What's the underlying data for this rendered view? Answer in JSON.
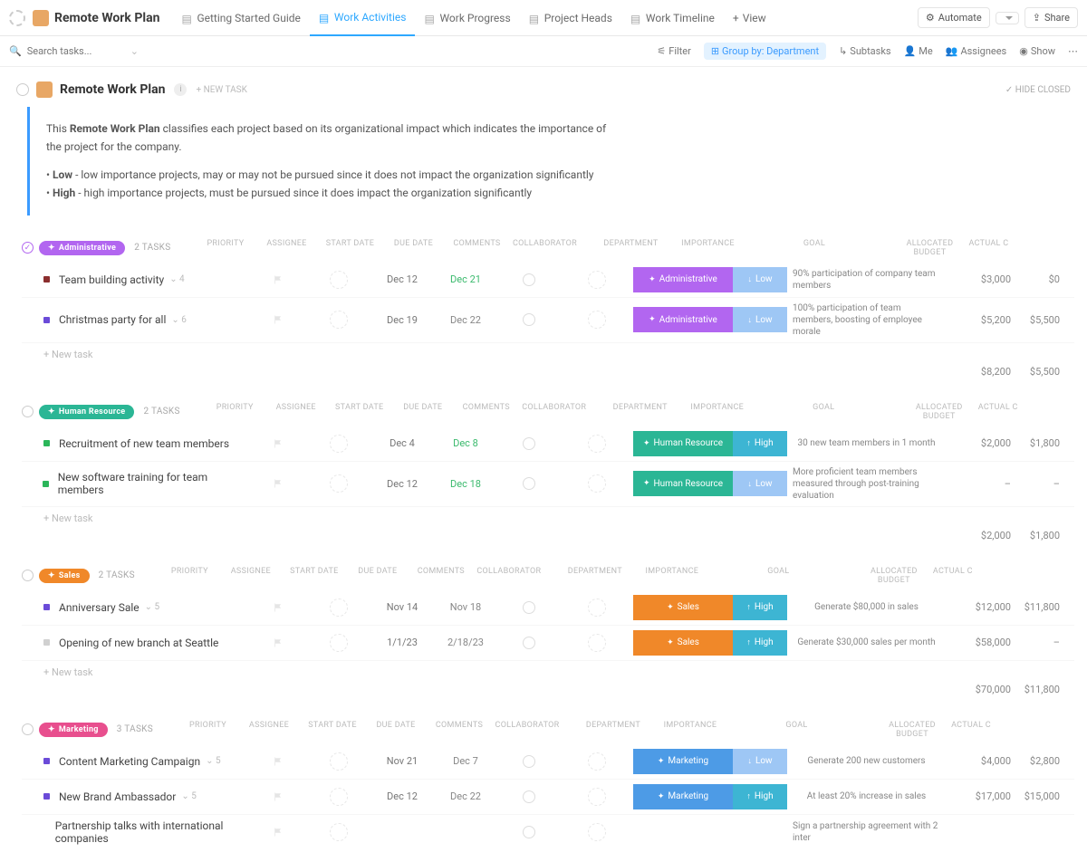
{
  "header": {
    "list_title": "Remote Work Plan",
    "tabs": [
      "Getting Started Guide",
      "Work Activities",
      "Work Progress",
      "Project Heads",
      "Work Timeline"
    ],
    "active_tab": "Work Activities",
    "view_btn": "View",
    "automate": "Automate",
    "share": "Share"
  },
  "toolbar": {
    "search_placeholder": "Search tasks...",
    "filter": "Filter",
    "group_by": "Group by: Department",
    "subtasks": "Subtasks",
    "me": "Me",
    "assignees": "Assignees",
    "show": "Show"
  },
  "page": {
    "title": "Remote Work Plan",
    "new_task": "+ NEW TASK",
    "hide_closed": "HIDE CLOSED",
    "desc_main": "This Remote Work Plan classifies each project based on its organizational impact which indicates the importance of the project for the company.",
    "desc_low": "• Low - low importance projects, may or may not be pursued since it does not impact the organization significantly",
    "desc_high": "• High - high importance projects, must be pursued since it does impact the organization significantly"
  },
  "columns": {
    "priority": "PRIORITY",
    "assignee": "ASSIGNEE",
    "start": "START DATE",
    "due": "DUE DATE",
    "comments": "COMMENTS",
    "collab": "COLLABORATOR",
    "dept": "DEPARTMENT",
    "importance": "IMPORTANCE",
    "goal": "GOAL",
    "budget": "ALLOCATED BUDGET",
    "actual": "ACTUAL C"
  },
  "groups": [
    {
      "name": "Administrative",
      "pill_color": "#b266f0",
      "count": "2 TASKS",
      "tasks": [
        {
          "dot": "#8b2e2e",
          "name": "Team building activity",
          "sub": "4",
          "sdate": "Dec 12",
          "ddate": "Dec 21",
          "ddate_cls": "date-green",
          "dept": "Administrative",
          "dept_cls": "dept-admin",
          "imp": "Low",
          "imp_cls": "imp-low",
          "imp_arrow": "↓",
          "goal": "90% participation of company team members",
          "budget": "$3,000",
          "actual": "$0"
        },
        {
          "dot": "#6b4bd8",
          "name": "Christmas party for all",
          "sub": "6",
          "sdate": "Dec 19",
          "ddate": "Dec 22",
          "ddate_cls": "",
          "dept": "Administrative",
          "dept_cls": "dept-admin",
          "imp": "Low",
          "imp_cls": "imp-low",
          "imp_arrow": "↓",
          "goal": "100% participation of team members, boosting of employee morale",
          "budget": "$5,200",
          "actual": "$5,500"
        }
      ],
      "totals": {
        "budget": "$8,200",
        "actual": "$5,500"
      }
    },
    {
      "name": "Human Resource",
      "pill_color": "#2bb695",
      "count": "2 TASKS",
      "tasks": [
        {
          "dot": "#2bb65a",
          "name": "Recruitment of new team members",
          "sub": "",
          "sdate": "Dec 4",
          "ddate": "Dec 8",
          "ddate_cls": "date-green",
          "dept": "Human Resource",
          "dept_cls": "dept-hr",
          "imp": "High",
          "imp_cls": "imp-high",
          "imp_arrow": "↑",
          "goal": "30 new team members in 1 month",
          "budget": "$2,000",
          "actual": "$1,800"
        },
        {
          "dot": "#2bb65a",
          "name": "New software training for team members",
          "sub": "",
          "sdate": "Dec 12",
          "ddate": "Dec 18",
          "ddate_cls": "date-green",
          "dept": "Human Resource",
          "dept_cls": "dept-hr",
          "imp": "Low",
          "imp_cls": "imp-low",
          "imp_arrow": "↓",
          "goal": "More proficient team members measured through post-training evaluation",
          "budget": "–",
          "actual": "–"
        }
      ],
      "totals": {
        "budget": "$2,000",
        "actual": "$1,800"
      }
    },
    {
      "name": "Sales",
      "pill_color": "#f08829",
      "count": "2 TASKS",
      "tasks": [
        {
          "dot": "#6b4bd8",
          "name": "Anniversary Sale",
          "sub": "5",
          "sdate": "Nov 14",
          "ddate": "Nov 18",
          "ddate_cls": "",
          "dept": "Sales",
          "dept_cls": "dept-sales",
          "imp": "High",
          "imp_cls": "imp-high",
          "imp_arrow": "↑",
          "goal": "Generate $80,000 in sales",
          "budget": "$12,000",
          "actual": "$11,800"
        },
        {
          "dot": "#d0d0d0",
          "name": "Opening of new branch at Seattle",
          "sub": "",
          "sdate": "1/1/23",
          "ddate": "2/18/23",
          "ddate_cls": "",
          "dept": "Sales",
          "dept_cls": "dept-sales",
          "imp": "High",
          "imp_cls": "imp-high",
          "imp_arrow": "↑",
          "goal": "Generate $30,000 sales per month",
          "budget": "$58,000",
          "actual": "–"
        }
      ],
      "totals": {
        "budget": "$70,000",
        "actual": "$11,800"
      }
    },
    {
      "name": "Marketing",
      "pill_color": "#e84f8e",
      "count": "3 TASKS",
      "tasks": [
        {
          "dot": "#6b4bd8",
          "name": "Content Marketing Campaign",
          "sub": "5",
          "sdate": "Nov 21",
          "ddate": "Dec 7",
          "ddate_cls": "",
          "dept": "Marketing",
          "dept_cls": "dept-mkt",
          "imp": "Low",
          "imp_cls": "imp-low",
          "imp_arrow": "↓",
          "goal": "Generate 200 new customers",
          "budget": "$4,000",
          "actual": "$2,800"
        },
        {
          "dot": "#6b4bd8",
          "name": "New Brand Ambassador",
          "sub": "5",
          "sdate": "Dec 12",
          "ddate": "Dec 22",
          "ddate_cls": "",
          "dept": "Marketing",
          "dept_cls": "dept-mkt",
          "imp": "High",
          "imp_cls": "imp-high",
          "imp_arrow": "↑",
          "goal": "At least 20% increase in sales",
          "budget": "$17,000",
          "actual": "$15,000"
        },
        {
          "dot": "#ffffff",
          "name": "Partnership talks with international companies",
          "sub": "",
          "sdate": "",
          "ddate": "",
          "ddate_cls": "",
          "dept": "",
          "dept_cls": "",
          "imp": "",
          "imp_cls": "",
          "imp_arrow": "",
          "goal": "Sign a partnership agreement with 2 inter",
          "budget": "",
          "actual": ""
        }
      ],
      "totals": null
    }
  ],
  "labels": {
    "new_task": "+ New task"
  }
}
